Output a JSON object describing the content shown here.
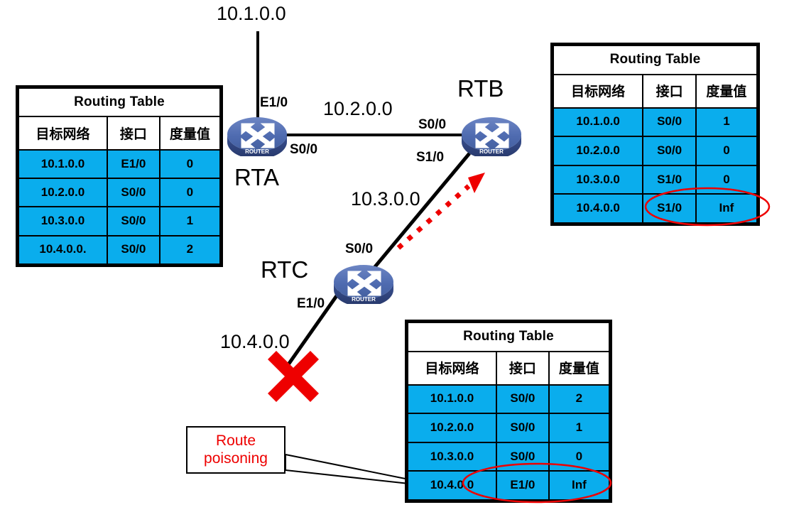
{
  "diagram": {
    "title": "RIP Route Poisoning Network Diagram",
    "colors": {
      "cell_blue": "#0aaded",
      "router_blue": "#4f6bb0",
      "router_blue_dark": "#2c3f73",
      "accent_red": "#ee0000",
      "line_black": "#000000"
    },
    "nodes": [
      {
        "id": "rta",
        "label": "RTA",
        "icon": "router-icon",
        "icon_caption": "ROUTER"
      },
      {
        "id": "rtb",
        "label": "RTB",
        "icon": "router-icon",
        "icon_caption": "ROUTER"
      },
      {
        "id": "rtc",
        "label": "RTC",
        "icon": "router-icon",
        "icon_caption": "ROUTER"
      }
    ],
    "networks": [
      {
        "id": "n1",
        "label": "10.1.0.0"
      },
      {
        "id": "n2",
        "label": "10.2.0.0"
      },
      {
        "id": "n3",
        "label": "10.3.0.0"
      },
      {
        "id": "n4",
        "label": "10.4.0.0"
      }
    ],
    "interfaces": [
      {
        "id": "rta-e10",
        "label": "E1/0",
        "node": "RTA"
      },
      {
        "id": "rta-s00",
        "label": "S0/0",
        "node": "RTA"
      },
      {
        "id": "rtb-s00",
        "label": "S0/0",
        "node": "RTB"
      },
      {
        "id": "rtb-s10",
        "label": "S1/0",
        "node": "RTB"
      },
      {
        "id": "rtc-s00",
        "label": "S0/0",
        "node": "RTC"
      },
      {
        "id": "rtc-e10",
        "label": "E1/0",
        "node": "RTC"
      }
    ],
    "annotations": {
      "link_down_marker": "red-x-mark",
      "poison_update_arrow": "red-dashed-arrow-rtc-to-rtb",
      "callout": {
        "text": "Route\npoisoning",
        "color": "#ee0000"
      },
      "highlight_ellipses": [
        {
          "table": "rtb",
          "row": 4,
          "columns": [
            "interface",
            "metric"
          ]
        },
        {
          "table": "rtc",
          "row": 4,
          "columns": [
            "interface",
            "metric"
          ]
        }
      ]
    }
  },
  "tables": {
    "rta": {
      "title": "Routing Table",
      "headers": [
        "目标网络",
        "接口",
        "度量值"
      ],
      "rows": [
        [
          "10.1.0.0",
          "E1/0",
          "0"
        ],
        [
          "10.2.0.0",
          "S0/0",
          "0"
        ],
        [
          "10.3.0.0",
          "S0/0",
          "1"
        ],
        [
          "10.4.0.0.",
          "S0/0",
          "2"
        ]
      ]
    },
    "rtb": {
      "title": "Routing Table",
      "headers": [
        "目标网络",
        "接口",
        "度量值"
      ],
      "rows": [
        [
          "10.1.0.0",
          "S0/0",
          "1"
        ],
        [
          "10.2.0.0",
          "S0/0",
          "0"
        ],
        [
          "10.3.0.0",
          "S1/0",
          "0"
        ],
        [
          "10.4.0.0",
          "S1/0",
          "Inf"
        ]
      ]
    },
    "rtc": {
      "title": "Routing Table",
      "headers": [
        "目标网络",
        "接口",
        "度量值"
      ],
      "rows": [
        [
          "10.1.0.0",
          "S0/0",
          "2"
        ],
        [
          "10.2.0.0",
          "S0/0",
          "1"
        ],
        [
          "10.3.0.0",
          "S0/0",
          "0"
        ],
        [
          "10.4.0.0",
          "E1/0",
          "Inf"
        ]
      ]
    }
  }
}
